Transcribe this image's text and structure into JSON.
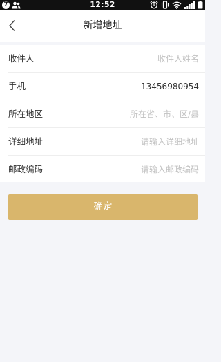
{
  "status_bar": {
    "time": "12:52",
    "notification_badge": "7",
    "icons": [
      "notification-icon",
      "people-icon",
      "alarm-icon",
      "vibrate-icon",
      "wifi-icon",
      "signal-icon",
      "battery-icon"
    ]
  },
  "navbar": {
    "back_icon": "chevron-left-icon",
    "title": "新增地址"
  },
  "form": {
    "fields": [
      {
        "label": "收件人",
        "value": "",
        "placeholder": "收件人姓名"
      },
      {
        "label": "手机",
        "value": "13456980954",
        "placeholder": ""
      },
      {
        "label": "所在地区",
        "value": "",
        "placeholder": "所在省、市、区/县"
      },
      {
        "label": "详细地址",
        "value": "",
        "placeholder": "请输入详细地址"
      },
      {
        "label": "邮政编码",
        "value": "",
        "placeholder": "请输入邮政编码"
      }
    ]
  },
  "confirm_button": {
    "label": "确定"
  },
  "colors": {
    "accent": "#d9b66c",
    "background": "#f4f5f9",
    "status_bar": "#111111"
  }
}
